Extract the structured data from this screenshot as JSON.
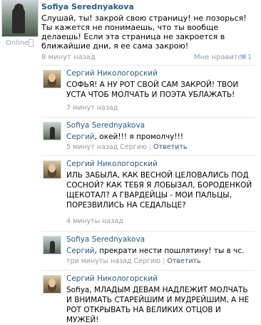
{
  "post": {
    "author": "Sofiya Serednyakova",
    "status": "Online",
    "text": "Слушай, ты! закрой свою страницу! не позорься! Ты кажется не понимаешь, что ты вообще делаешь! Если эта страница не закроется в ближайшие дни, я ее сама закрою!",
    "time": "8 минут назад",
    "like_label": "Мне нравится",
    "like_count": "1"
  },
  "replies": [
    {
      "author": "Сергий Никологорский",
      "mention": "",
      "text": "СОФЬЯ! А НУ РОТ СВОЙ САМ ЗАКРОЙ! ТВОИ УСТА ЧТОБ МОЛЧАТЬ И ПОЭТА УБЛАЖАТЬ!",
      "time": "7 минут назад",
      "reply_to": "",
      "reply_label": ""
    },
    {
      "author": "Sofiya Serednyakova",
      "mention": "Сергий",
      "text": ", окей!!! я промолчу!!!",
      "time": "5 минут назад Сергию",
      "reply_label": "Ответить"
    },
    {
      "author": "Сергий Никологорский",
      "mention": "",
      "text": "ИЛЬ ЗАБЫЛА, КАК ВЕСНОЙ ЦЕЛОВАЛИСЬ ПОД СОСНОЙ? КАК ТЕБЯ Я ЛОБЫЗАЛ, БОРОДЕНКОЙ ЩЕКОТАЛ? А ГВАРДЕЙЦЫ - МОИ ПАЛЬЦЫ, ПОРЕЗВИЛИСЬ НА СЕДАЛЬЦЕ?",
      "time": "4 минуты назад",
      "reply_label": ""
    },
    {
      "author": "Sofiya Serednyakova",
      "mention": "Сергий",
      "text": ", прекрати нести пошлятину! ты в чс.",
      "time": "три минуты назад Сергию",
      "reply_label": "Ответить"
    },
    {
      "author": "Сергий Никологорский",
      "mention": "",
      "text": "Sofiya, МЛАДЫМ ДЕВАМ НАДЛЕЖИТ МОЛЧАТЬ И ВНИМАТЬ СТАРЕЙШИМ И МУДРЕЙШИМ, А НЕ РОТ ОТКРЫВАТЬ НА ВЕЛИКИХ ОТЦОВ И МУЖЕЙ!",
      "time": "",
      "reply_label": ""
    }
  ]
}
